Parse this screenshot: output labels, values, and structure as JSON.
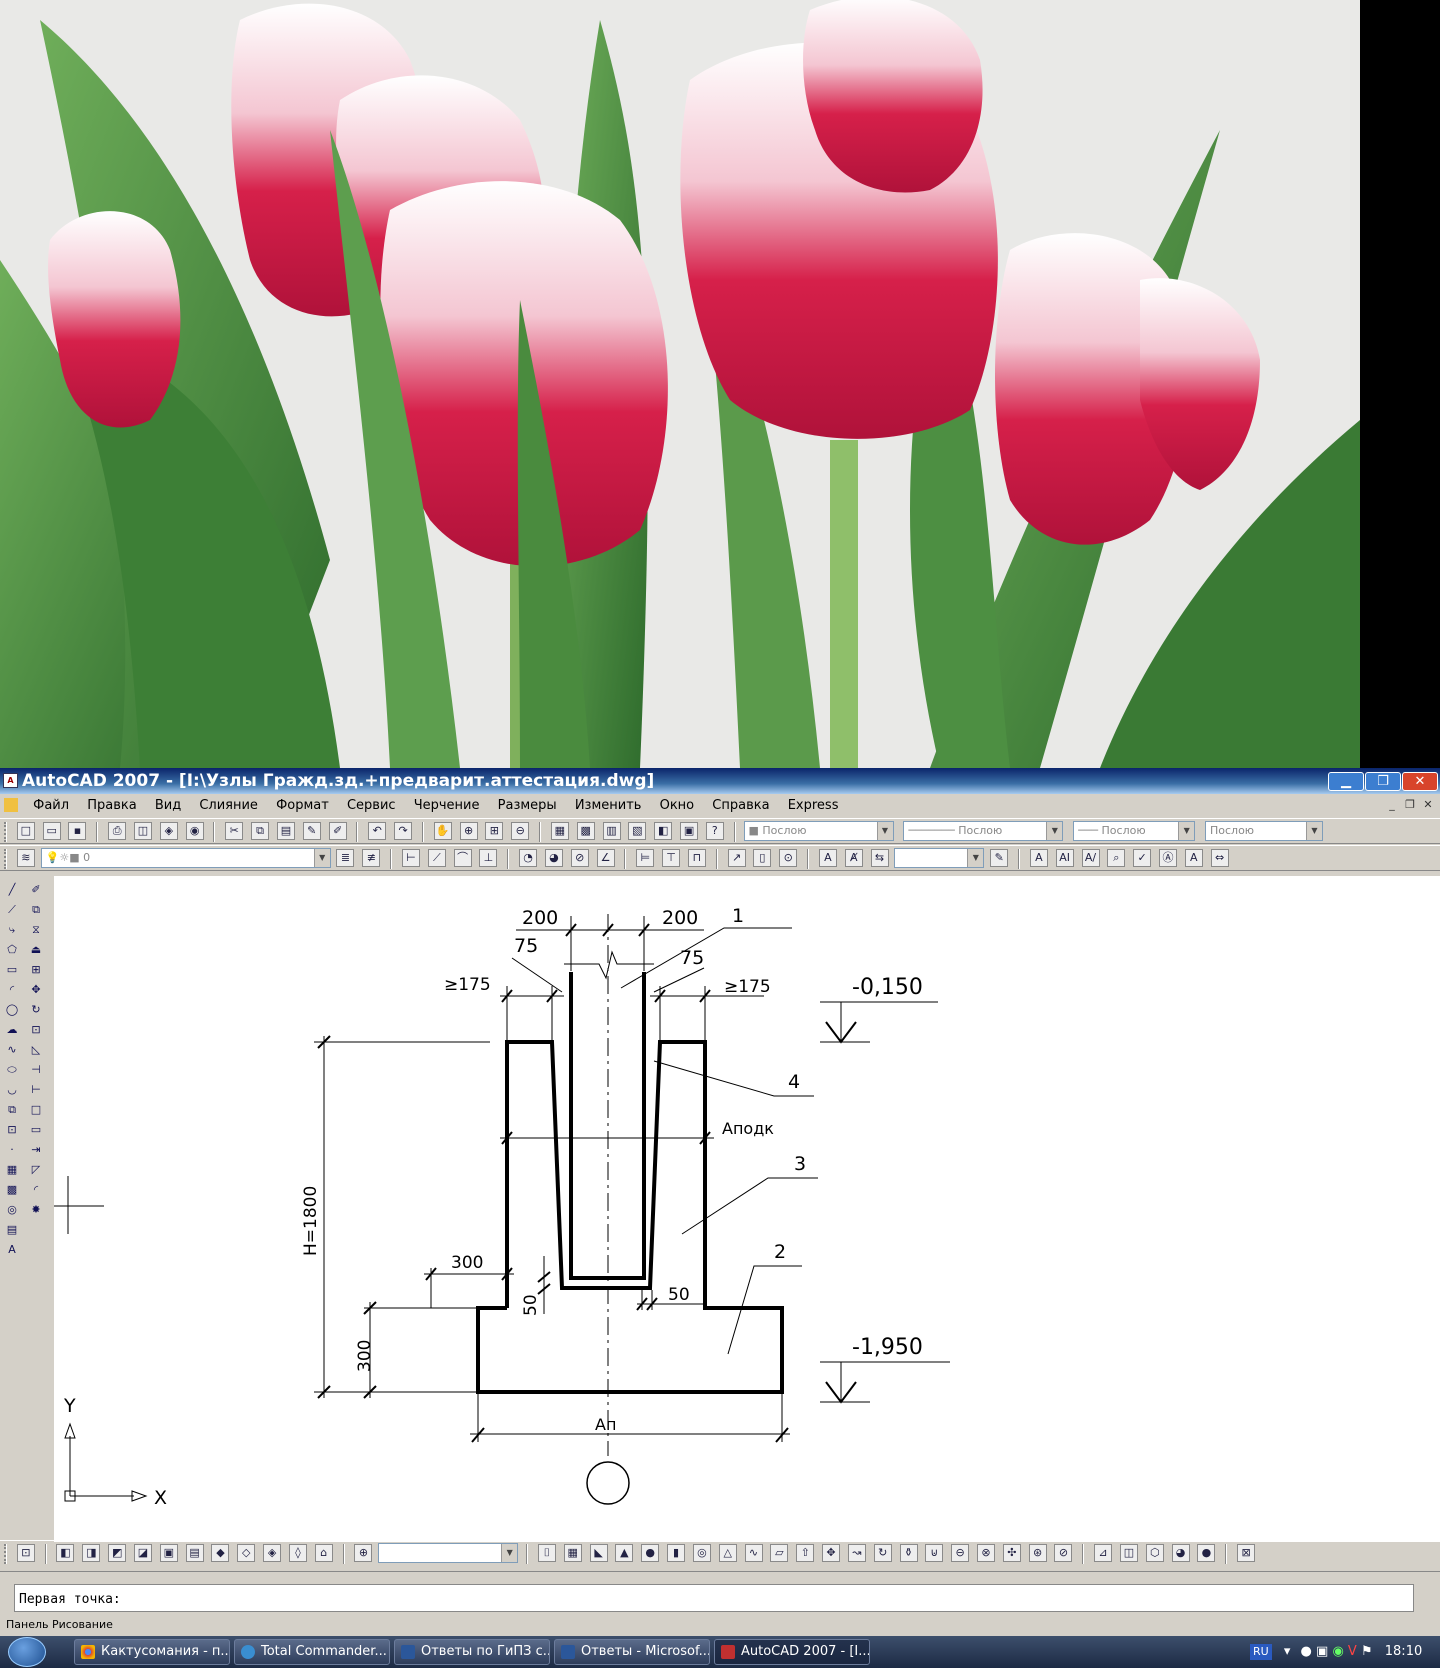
{
  "colors": {
    "title_bar": "#0a246a",
    "workspace": "#ffffff",
    "taskbar": "#1c2a44",
    "petal_red": "#d6204a",
    "leaf_green": "#3f8a3a"
  },
  "window": {
    "title": "AutoCAD 2007 - [I:\\Узлы Гражд.зд.+предварит.аттестация.dwg]",
    "minimize": "▁",
    "restore": "❐",
    "close": "✕"
  },
  "menu": [
    "Файл",
    "Правка",
    "Вид",
    "Слияние",
    "Формат",
    "Сервис",
    "Черчение",
    "Размеры",
    "Изменить",
    "Окно",
    "Справка",
    "Express"
  ],
  "props": {
    "color": "Послою",
    "linetype": "Послою",
    "lineweight": "Послою",
    "plotstyle": "Послою"
  },
  "layer": {
    "current": "0"
  },
  "drawing": {
    "dims": [
      "200",
      "200",
      "1",
      "75",
      "75",
      "≥175",
      "≥175",
      "-0,150",
      "4",
      "Aподк",
      "3",
      "H=1800",
      "300",
      "50",
      "50",
      "2",
      "-1,950",
      "300",
      "Aп"
    ],
    "axis_y": "Y",
    "axis_x": "X"
  },
  "command": {
    "prompt": "Первая точка:"
  },
  "status": {
    "panel": "Панель Рисование"
  },
  "taskbar": {
    "items": [
      "Кактусомания - п...",
      "Total Commander...",
      "Ответы по ГиПЗ с...",
      "Ответы - Microsof...",
      "AutoCAD 2007 - [I..."
    ],
    "lang": "RU",
    "clock": "18:10"
  }
}
